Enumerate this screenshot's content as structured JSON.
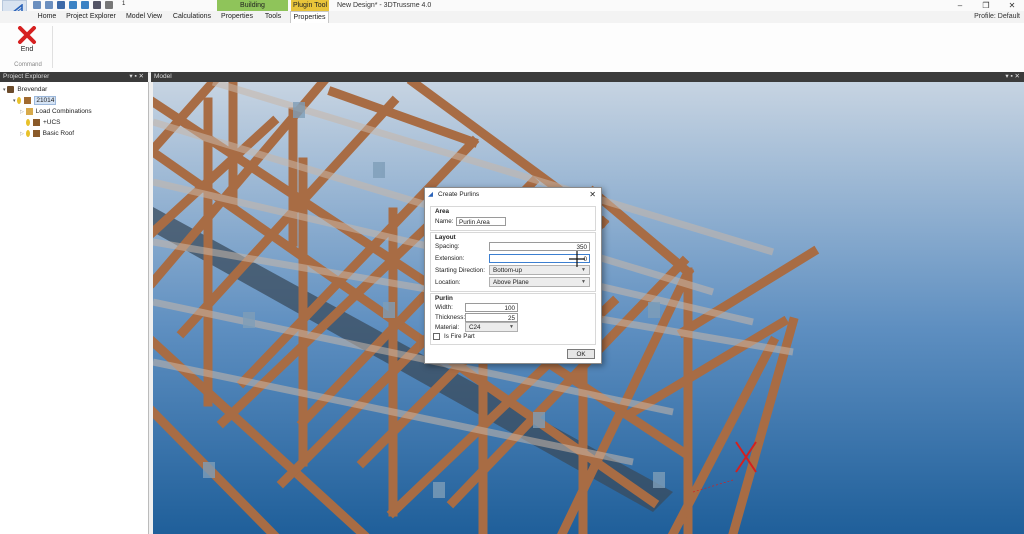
{
  "window": {
    "title": "New Design* - 3DTrussme 4.0",
    "context_tabs": [
      "Building",
      "Plugin Tool"
    ],
    "quick_access_extra": "1"
  },
  "ribbon": {
    "tabs": [
      "Home",
      "Project Explorer",
      "Model View",
      "Calculations",
      "Properties",
      "Tools",
      "Properties"
    ],
    "active_tab_index": 6,
    "profile_label": "Profile: Default",
    "end_button_label": "End",
    "group_label": "Command"
  },
  "project_explorer": {
    "title": "Project Explorer",
    "tree": {
      "root": "Brevendar",
      "project": "21014",
      "children": [
        "Load Combinations",
        "+UCS",
        "Basic Roof"
      ]
    }
  },
  "model": {
    "title": "Model"
  },
  "dialog": {
    "title": "Create Purlins",
    "area": {
      "title": "Area",
      "name_label": "Name:",
      "name_value": "Purlin Area"
    },
    "layout": {
      "title": "Layout",
      "spacing_label": "Spacing:",
      "spacing_value": "350",
      "extension_label": "Extension:",
      "extension_value": "0",
      "starting_direction_label": "Starting Direction:",
      "starting_direction_value": "Bottom-up",
      "location_label": "Location:",
      "location_value": "Above Plane"
    },
    "purlin": {
      "title": "Purlin",
      "width_label": "Width:",
      "width_value": "100",
      "thickness_label": "Thickness:",
      "thickness_value": "25",
      "material_label": "Material:",
      "material_value": "C24",
      "fire_part_label": "Is Fire Part",
      "fire_part_checked": false
    },
    "ok_label": "OK"
  },
  "colors": {
    "timber": "#b07248",
    "sky_top": "#c7d4e2",
    "sky_bottom": "#1f5f9a",
    "marker": "#d42020"
  }
}
